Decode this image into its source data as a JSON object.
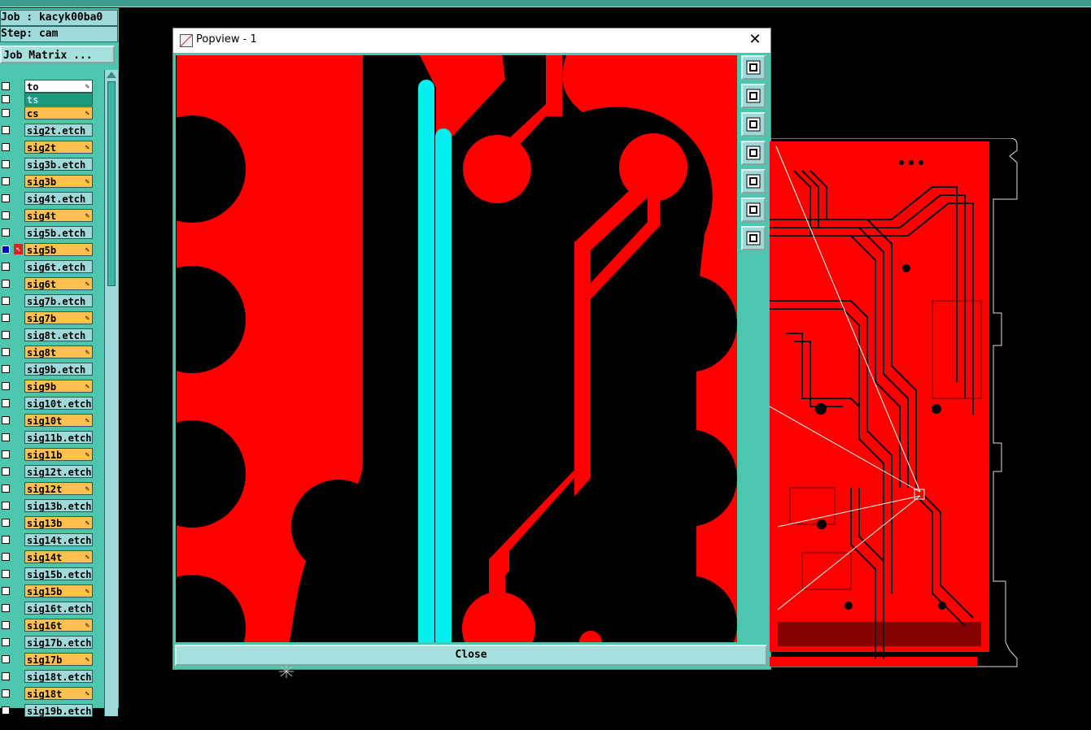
{
  "job": {
    "label": "Job : kacyk00ba0",
    "step": "Step: cam",
    "matrix_button": "Job Matrix ..."
  },
  "layers": [
    {
      "name": "to",
      "style": "white"
    },
    {
      "name": "ts",
      "style": "teal"
    },
    {
      "name": "cs",
      "style": "orange"
    },
    {
      "name": "sig2t.etch",
      "style": "etch"
    },
    {
      "name": "sig2t",
      "style": "orange"
    },
    {
      "name": "sig3b.etch",
      "style": "etch"
    },
    {
      "name": "sig3b",
      "style": "orange"
    },
    {
      "name": "sig4t.etch",
      "style": "etch"
    },
    {
      "name": "sig4t",
      "style": "orange"
    },
    {
      "name": "sig5b.etch",
      "style": "etch"
    },
    {
      "name": "sig5b",
      "style": "orange",
      "active": true
    },
    {
      "name": "sig6t.etch",
      "style": "etch"
    },
    {
      "name": "sig6t",
      "style": "orange"
    },
    {
      "name": "sig7b.etch",
      "style": "etch"
    },
    {
      "name": "sig7b",
      "style": "orange"
    },
    {
      "name": "sig8t.etch",
      "style": "etch"
    },
    {
      "name": "sig8t",
      "style": "orange"
    },
    {
      "name": "sig9b.etch",
      "style": "etch"
    },
    {
      "name": "sig9b",
      "style": "orange"
    },
    {
      "name": "sig10t.etch",
      "style": "etch"
    },
    {
      "name": "sig10t",
      "style": "orange"
    },
    {
      "name": "sig11b.etch",
      "style": "etch"
    },
    {
      "name": "sig11b",
      "style": "orange"
    },
    {
      "name": "sig12t.etch",
      "style": "etch"
    },
    {
      "name": "sig12t",
      "style": "orange"
    },
    {
      "name": "sig13b.etch",
      "style": "etch"
    },
    {
      "name": "sig13b",
      "style": "orange"
    },
    {
      "name": "sig14t.etch",
      "style": "etch"
    },
    {
      "name": "sig14t",
      "style": "orange"
    },
    {
      "name": "sig15b.etch",
      "style": "etch"
    },
    {
      "name": "sig15b",
      "style": "orange"
    },
    {
      "name": "sig16t.etch",
      "style": "etch"
    },
    {
      "name": "sig16t",
      "style": "orange"
    },
    {
      "name": "sig17b.etch",
      "style": "etch"
    },
    {
      "name": "sig17b",
      "style": "orange"
    },
    {
      "name": "sig18t.etch",
      "style": "etch"
    },
    {
      "name": "sig18t",
      "style": "orange"
    },
    {
      "name": "sig19b.etch",
      "style": "etch"
    }
  ],
  "popup": {
    "title": "Popview - 1",
    "close_label": "Close"
  },
  "tools": [
    "zoom-window-icon",
    "pan-up-icon",
    "pan-down-icon",
    "pan-left-icon",
    "pan-right-icon",
    "fit-screen-icon",
    "zoom-home-icon"
  ],
  "colors": {
    "copper": "#ff0000",
    "highlight": "#00f0f0",
    "panel": "#4ec5ad",
    "button": "#9fdada",
    "layer_orange": "#ffc14d"
  }
}
